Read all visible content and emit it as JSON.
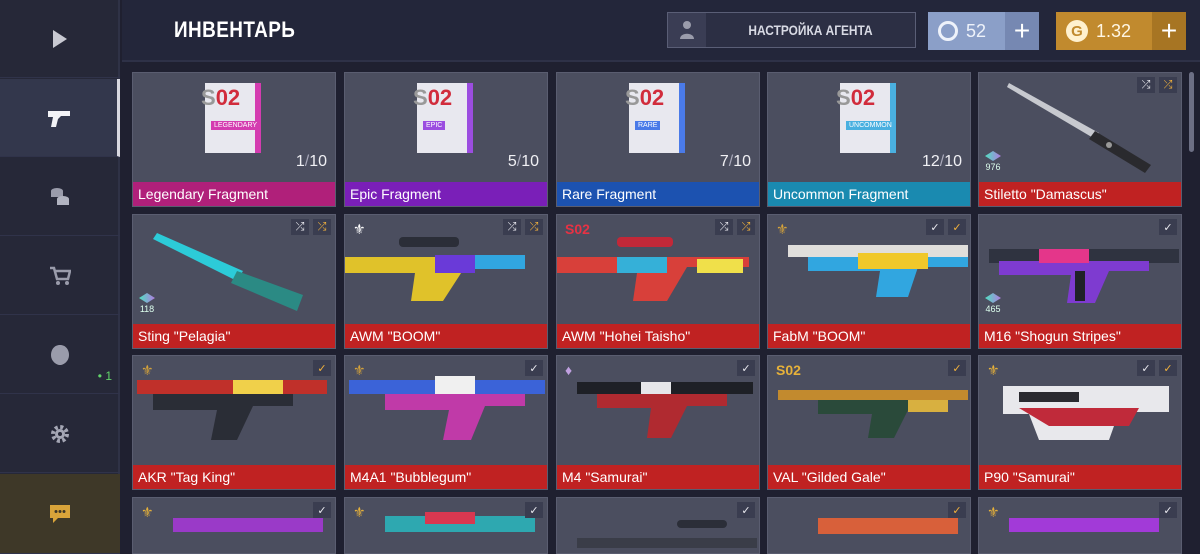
{
  "header": {
    "title": "ИНВЕНТАРЬ",
    "agent_button": "НАСТРОЙКА АГЕНТА",
    "credits": {
      "value": "52",
      "plus": "+"
    },
    "gold": {
      "value": "1.32",
      "plus": "+"
    }
  },
  "sidebar": {
    "items": [
      {
        "icon": "play-icon"
      },
      {
        "icon": "gun-icon",
        "active": true
      },
      {
        "icon": "coins-icon"
      },
      {
        "icon": "cart-icon"
      },
      {
        "icon": "clan-icon",
        "badge": "• 1"
      },
      {
        "icon": "gear-icon"
      },
      {
        "icon": "chat-icon"
      }
    ]
  },
  "fragments": [
    {
      "name": "Legendary Fragment",
      "label": "LEGENDARY",
      "count": "1",
      "total": "10",
      "color": "#d43cb0"
    },
    {
      "name": "Epic Fragment",
      "label": "EPIC",
      "count": "5",
      "total": "10",
      "color": "#9b4de0"
    },
    {
      "name": "Rare Fragment",
      "label": "RARE",
      "count": "7",
      "total": "10",
      "color": "#4a7ae8"
    },
    {
      "name": "Uncommon Fragment",
      "label": "UNCOMMON",
      "count": "12",
      "total": "10",
      "color": "#4ab0e0"
    }
  ],
  "items": [
    {
      "name": "Stiletto \"Damascus\"",
      "rarity_count": "976"
    },
    {
      "name": "Sting \"Pelagia\"",
      "rarity_count": "118"
    },
    {
      "name": "AWM \"BOOM\""
    },
    {
      "name": "AWM \"Hohei Taisho\""
    },
    {
      "name": "FabM \"BOOM\""
    },
    {
      "name": "M16 \"Shogun Stripes\"",
      "rarity_count": "465"
    },
    {
      "name": "AKR \"Tag King\""
    },
    {
      "name": "M4A1 \"Bubblegum\""
    },
    {
      "name": "M4 \"Samurai\""
    },
    {
      "name": "VAL \"Gilded Gale\""
    },
    {
      "name": "P90 \"Samurai\""
    }
  ],
  "sticker_text": "S02",
  "colors": {
    "legendary": "#b0207a",
    "epic": "#7a1fb8",
    "rare": "#1c52b0",
    "uncommon": "#1a8ab0",
    "name_bar": "#c02222"
  }
}
